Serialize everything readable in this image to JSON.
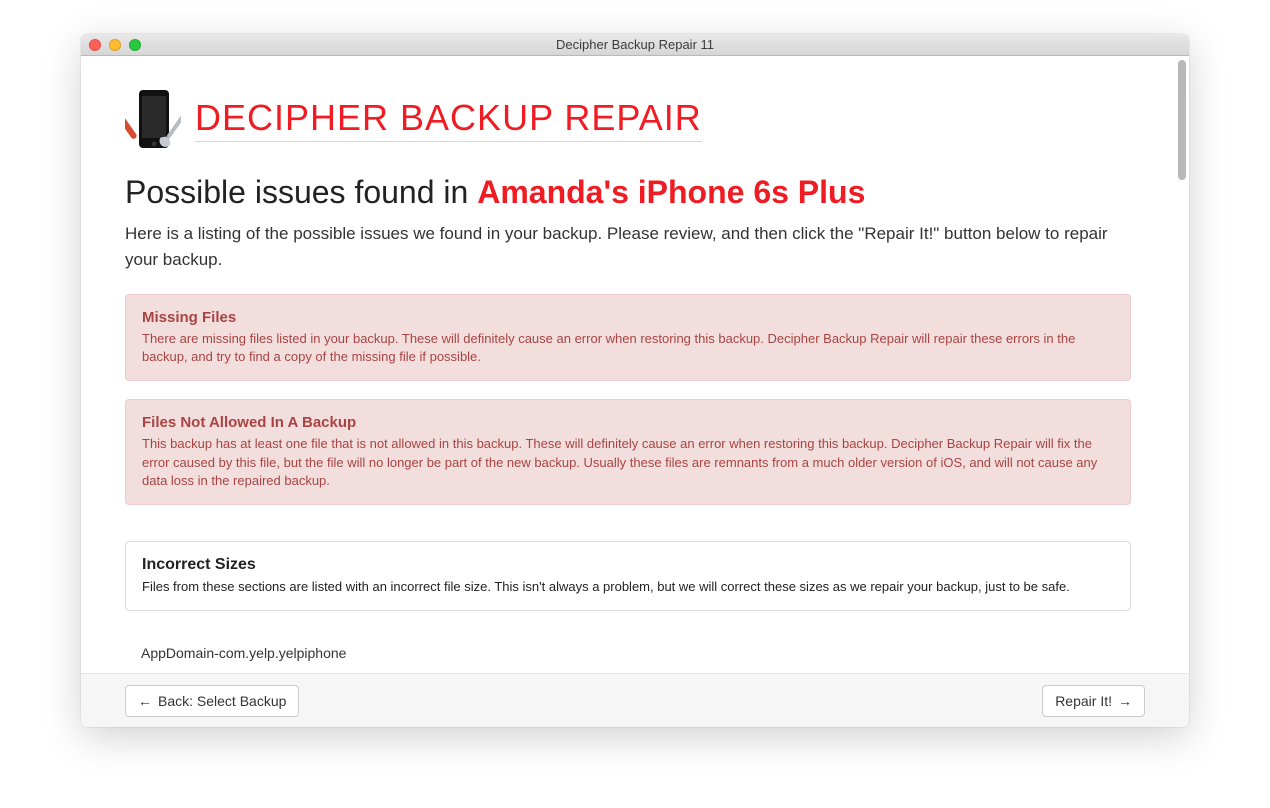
{
  "window": {
    "title": "Decipher Backup Repair 11"
  },
  "brand": {
    "title": "DECIPHER BACKUP REPAIR"
  },
  "heading": {
    "prefix": "Possible issues found in ",
    "device": "Amanda's iPhone 6s Plus"
  },
  "intro": "Here is a listing of the possible issues we found in your backup. Please review, and then click the \"Repair It!\" button below to repair your backup.",
  "issues": [
    {
      "title": "Missing Files",
      "body": "There are missing files listed in your backup. These will definitely cause an error when restoring this backup. Decipher Backup Repair will repair these errors in the backup, and try to find a copy of the missing file if possible."
    },
    {
      "title": "Files Not Allowed In A Backup",
      "body": "This backup has at least one file that is not allowed in this backup. These will definitely cause an error when restoring this backup. Decipher Backup Repair will fix the error caused by this file, but the file will no longer be part of the new backup. Usually these files are remnants from a much older version of iOS, and will not cause any data loss in the repaired backup."
    }
  ],
  "neutral_issue": {
    "title": "Incorrect Sizes",
    "body": "Files from these sections are listed with an incorrect file size. This isn't always a problem, but we will correct these sizes as we repair your backup, just to be safe."
  },
  "cutoff_text": "AppDomain-com.yelp.yelpiphone",
  "footer": {
    "back_label": "Back: Select Backup",
    "repair_label": "Repair It!"
  }
}
